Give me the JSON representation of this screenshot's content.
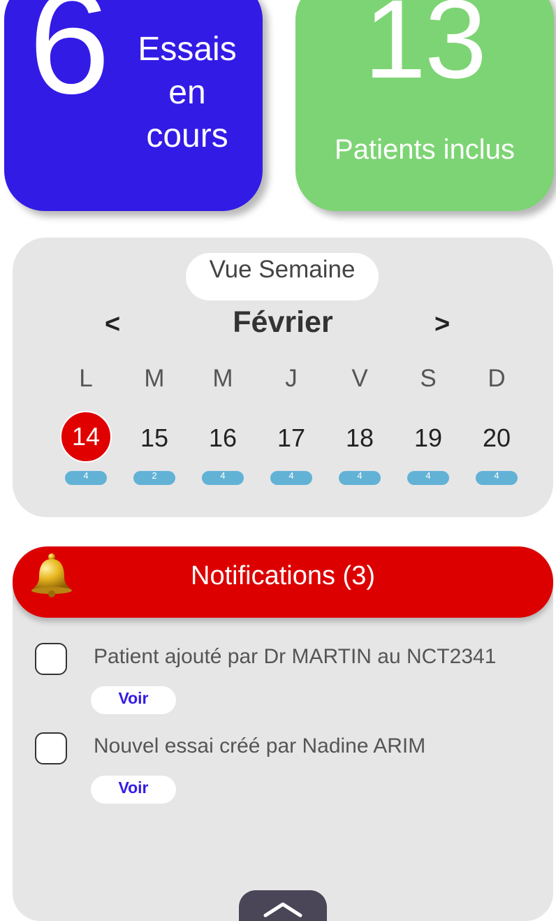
{
  "stats": {
    "trials": {
      "value": "6",
      "label_lines": [
        "Essais",
        "en",
        "cours"
      ]
    },
    "patients": {
      "value": "13",
      "label": "Patients inclus"
    }
  },
  "calendar": {
    "view_label": "Vue Semaine",
    "prev": "<",
    "next": ">",
    "month": "Février",
    "weekdays": [
      "L",
      "M",
      "M",
      "J",
      "V",
      "S",
      "D"
    ],
    "days": [
      "14",
      "15",
      "16",
      "17",
      "18",
      "19",
      "20"
    ],
    "today_index": 0,
    "event_counts": [
      "4",
      "2",
      "4",
      "4",
      "4",
      "4",
      "4"
    ],
    "colors": {
      "today": "#e00000",
      "count_pill": "#62b2d6"
    }
  },
  "notifications": {
    "title": "Notifications (3)",
    "icon": "bell-icon",
    "items": [
      {
        "text": "Patient ajouté par Dr MARTIN au NCT2341",
        "action": "Voir"
      },
      {
        "text": "Nouvel essai créé par Nadine ARIM",
        "action": "Voir"
      }
    ],
    "collapse_icon": "chevron-up-icon"
  },
  "colors": {
    "trials_card": "#331be6",
    "patients_card": "#7dd474",
    "notifications_header": "#dd0000"
  }
}
